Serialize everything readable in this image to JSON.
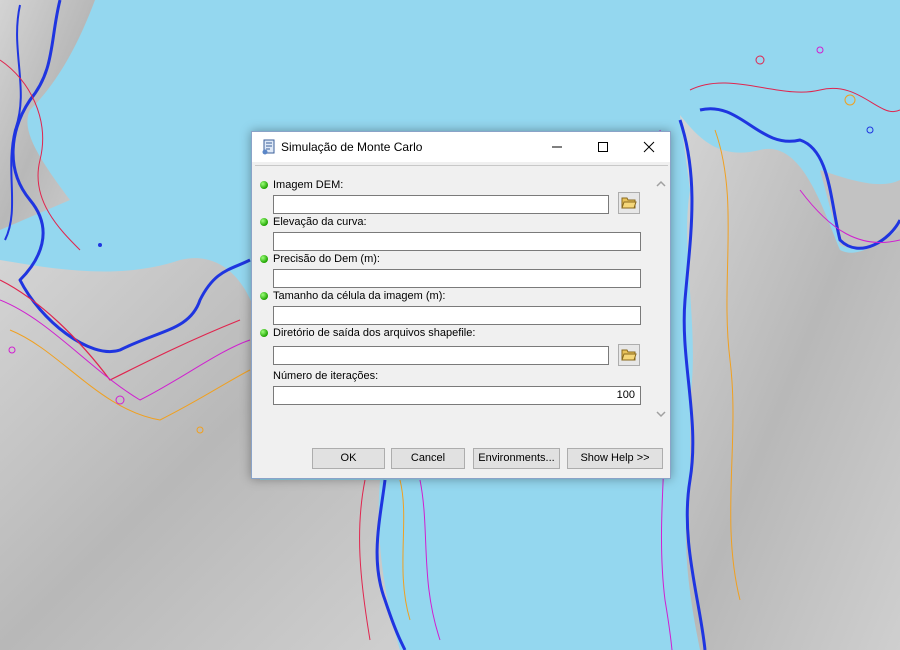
{
  "window": {
    "title": "Simulação de Monte Carlo",
    "icon": "script-tool-icon",
    "controls": [
      "minimize-icon",
      "maximize-icon",
      "close-icon"
    ]
  },
  "parameters": [
    {
      "label": "Imagem DEM:",
      "required": true,
      "value": "",
      "has_browse": true
    },
    {
      "label": "Elevação da curva:",
      "required": true,
      "value": "",
      "has_browse": false
    },
    {
      "label": "Precisão do  Dem (m):",
      "required": true,
      "value": "",
      "has_browse": false
    },
    {
      "label": "Tamanho da célula da imagem (m):",
      "required": true,
      "value": "",
      "has_browse": false
    },
    {
      "label": "Diretório de saída dos arquivos shapefile:",
      "required": true,
      "value": "",
      "has_browse": true
    },
    {
      "label": "Número de iterações:",
      "required": false,
      "value": "100",
      "has_browse": false
    }
  ],
  "buttons": {
    "ok": "OK",
    "cancel": "Cancel",
    "environments": "Environments...",
    "help": "Show Help >>"
  },
  "colors": {
    "water": "#94d7ef",
    "land": "#c8c8c8",
    "contour_main": "#1f35e0",
    "contour_red": "#e0254e",
    "contour_magenta": "#d01fd0",
    "contour_orange": "#f0a020",
    "required_dot": "#1ea300"
  }
}
